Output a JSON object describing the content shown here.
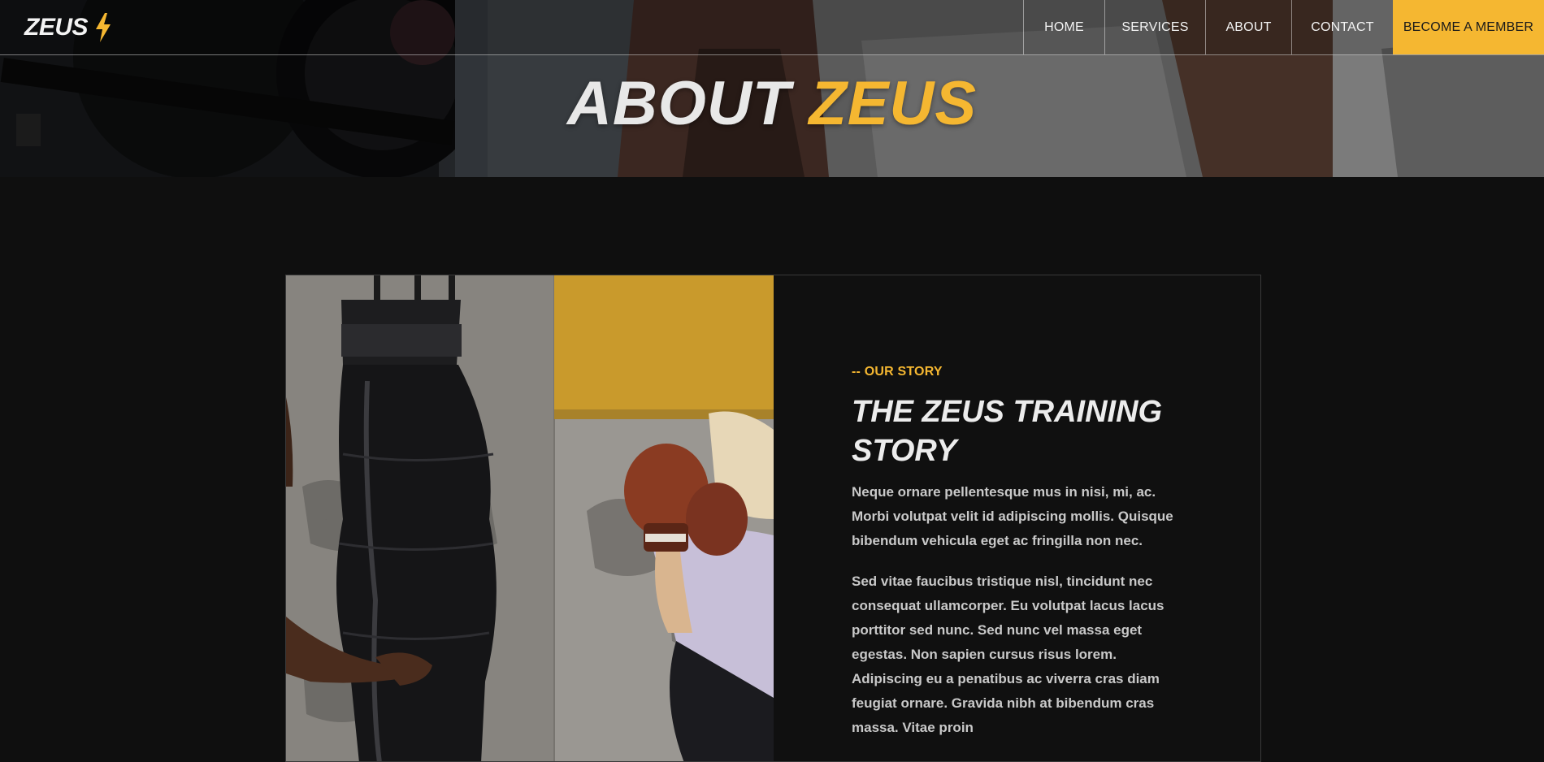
{
  "nav": {
    "logo_text": "ZEUS",
    "logo_icon": "lightning-bolt-icon",
    "links": [
      {
        "label": "HOME"
      },
      {
        "label": "SERVICES"
      },
      {
        "label": "ABOUT"
      },
      {
        "label": "CONTACT"
      }
    ],
    "cta_label": "BECOME A MEMBER"
  },
  "hero": {
    "title_main": "ABOUT",
    "title_accent": "ZEUS"
  },
  "story": {
    "eyebrow": "-- OUR STORY",
    "title": "THE ZEUS TRAINING STORY",
    "paragraphs": [
      "Neque ornare pellentesque mus in nisi, mi, ac. Morbi volutpat velit id adipiscing mollis. Quisque bibendum vehicula eget ac fringilla non nec.",
      "Sed vitae faucibus tristique nisl, tincidunt nec consequat ullamcorper. Eu volutpat lacus lacus porttitor sed nunc. Sed nunc vel massa eget egestas. Non sapien cursus risus lorem. Adipiscing eu a penatibus ac viverra cras diam feugiat ornare. Gravida nibh at bibendum cras massa. Vitae proin"
    ]
  },
  "colors": {
    "accent": "#f5b731",
    "background": "#0f0f0f",
    "text_light": "#ececec",
    "text_muted": "#c9c9c9"
  }
}
